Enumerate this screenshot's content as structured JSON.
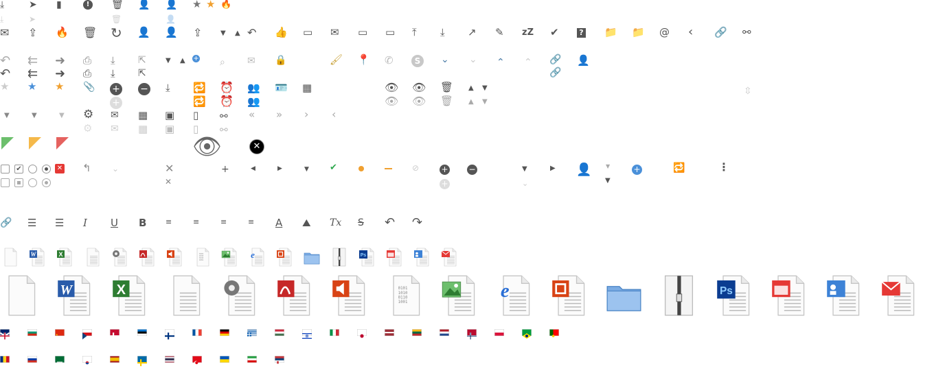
{
  "colors": {
    "gray": "#555555",
    "light_gray": "#c8c8c8",
    "blue": "#4a90d9",
    "orange": "#f0a030",
    "red": "#e53935",
    "green": "#2fa84f"
  },
  "icon_sprite": {
    "row1": [
      "download-tray-icon",
      "paper-plane-icon",
      "note-icon",
      "exclamation-circle-icon",
      "trash-icon",
      "user-icon",
      "user-outline-icon",
      "star-icon",
      "star-highlight-icon",
      "fire-icon"
    ],
    "row3": [
      "envelope-open-icon",
      "tray-upload-icon",
      "fire-icon",
      "trash-icon",
      "refresh-icon",
      "add-user-icon",
      "add-user-icon",
      "tray-upload-icon",
      "caret-down-icon",
      "caret-up-icon",
      "reply-icon",
      "thumbs-up-icon",
      "tray-x-icon",
      "envelope-x-icon",
      "tray-x-icon",
      "tray-open-icon",
      "upload-icon",
      "download-icon",
      "share-icon",
      "pencil-icon",
      "snooze-icon",
      "doc-signed-icon",
      "help-icon",
      "folder-plus-icon",
      "folder-plus-icon",
      "at-icon",
      "chevron-left-icon",
      "link-icon",
      "unlink-icon"
    ],
    "row4": [
      "reply-icon",
      "reply-all-icon",
      "forward-icon",
      "print-icon",
      "download-icon",
      "external-link-icon",
      "caret-down-icon",
      "caret-up-icon",
      "plus-circle-icon",
      "search-icon",
      "envelope-icon",
      "lock-icon",
      "brush-icon",
      "map-marker-icon",
      "phone-icon",
      "skype-icon",
      "chevron-down-icon",
      "chevron-down-icon",
      "chevron-up-icon",
      "chevron-up-icon",
      "link-icon",
      "user-icon"
    ],
    "row6": [
      "star-icon",
      "star-icon",
      "star-icon",
      "paperclip-icon",
      "plus-circle-icon",
      "minus-circle-icon",
      "download-icon",
      "repeat-icon",
      "alarm-icon",
      "users-icon",
      "contact-card-icon",
      "calendar-icon",
      "eye-icon",
      "eye-slash-icon",
      "trash-icon",
      "sort-up-icon",
      "sort-down-icon",
      "resize-icon"
    ],
    "row8": [
      "caret-down-icon",
      "caret-down-icon",
      "caret-down-icon",
      "gear-icon",
      "envelope-icon",
      "calendar-icon",
      "outlook-icon",
      "mobile-icon",
      "glasses-icon",
      "double-left-icon",
      "double-right-icon",
      "chevron-right-icon",
      "chevron-left-icon"
    ],
    "row10": [
      "flag-green-icon",
      "flag-orange-icon",
      "flag-red-icon",
      "apple-icon",
      "eye-large-icon",
      "close-circle-icon"
    ],
    "row11": [
      "checkbox-icon",
      "checkbox-checked-icon",
      "radio-icon",
      "radio-checked-icon",
      "close-red-icon",
      "back-arrow-icon",
      "chevron-down-icon",
      "times-icon",
      "plus-icon",
      "caret-left-icon",
      "caret-right-icon",
      "caret-down-icon",
      "check-icon",
      "dot-orange-icon",
      "dash-orange-icon",
      "ban-icon",
      "plus-circle-icon",
      "minus-circle-icon",
      "caret-down-icon",
      "caret-right-icon",
      "user-icon",
      "caret-down-icon",
      "plus-circle-blue-icon",
      "repeat-icon",
      "kebab-icon"
    ],
    "editor": [
      "link-icon",
      "ordered-list-icon",
      "unordered-list-icon",
      "italic-icon",
      "underline-icon",
      "bold-icon",
      "align-left-icon",
      "align-center-icon",
      "align-right-icon",
      "align-justify-icon",
      "font-color-icon",
      "image-icon",
      "clear-format-icon",
      "strikethrough-icon",
      "undo-icon",
      "redo-icon"
    ],
    "filetypes": [
      "blank",
      "word",
      "excel",
      "text",
      "settings",
      "pdf",
      "audio",
      "binary",
      "image",
      "web",
      "powerpoint",
      "folder",
      "archive",
      "photoshop",
      "calendar",
      "contact",
      "mail"
    ],
    "flags_row1": [
      "uk",
      "bulgaria",
      "china",
      "czech",
      "denmark",
      "estonia",
      "finland",
      "france",
      "germany",
      "greece",
      "hungary",
      "israel",
      "italy",
      "japan",
      "latvia",
      "lithuania",
      "netherlands",
      "norway",
      "poland",
      "brazil",
      "portugal"
    ],
    "flags_row2": [
      "romania",
      "russia",
      "saudi-arabia",
      "south-korea",
      "spain",
      "sweden",
      "thailand",
      "turkey",
      "ukraine",
      "iran",
      "serbia"
    ]
  },
  "glyphs": {
    "binary": "01001010\n10101010\n01010101\n10010101\n01001010",
    "tx": "Tx",
    "zz": "zZ",
    "at": "@",
    "i": "I",
    "u": "U",
    "b": "B",
    "a": "A",
    "s": "S",
    "help": "?",
    "excl": "!",
    "word_w": "W",
    "excel_x": "X",
    "ps": "Ps",
    "ie_e": "e"
  }
}
